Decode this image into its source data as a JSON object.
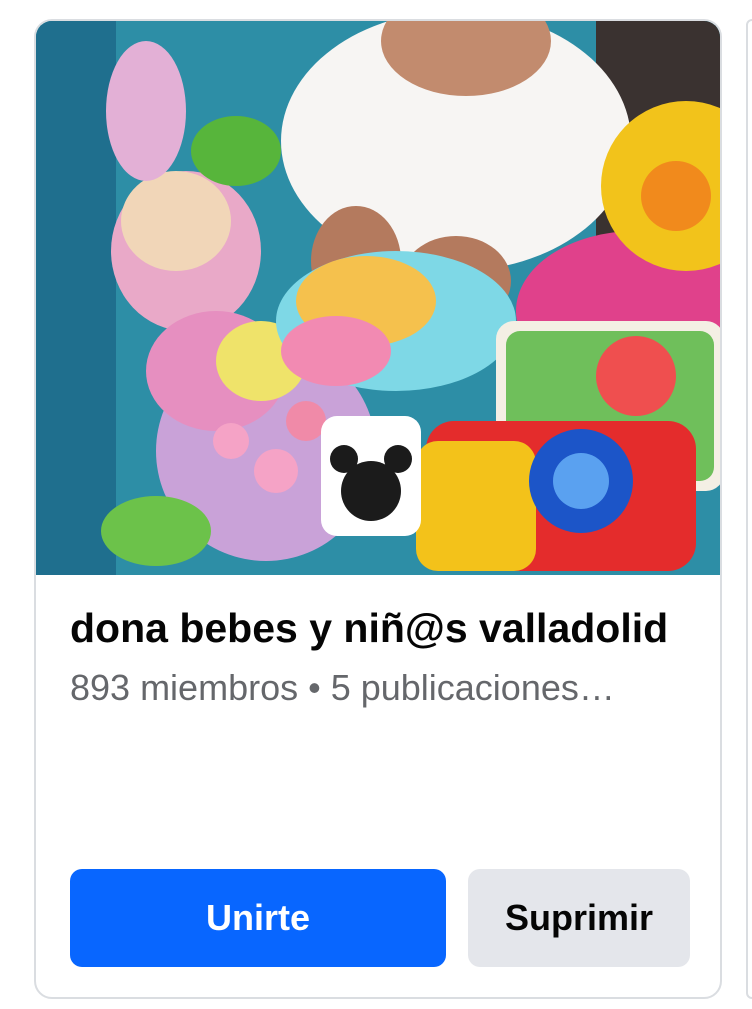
{
  "group": {
    "name": "dona bebes y niñ@s valladolid",
    "meta": "893 miembros • 5 publicaciones…",
    "photo_description": "group-cover-photo"
  },
  "actions": {
    "join_label": "Unirte",
    "remove_label": "Suprimir"
  },
  "colors": {
    "primary": "#0866ff",
    "secondary_bg": "#e4e6eb",
    "text": "#050505",
    "muted": "#65676b"
  }
}
